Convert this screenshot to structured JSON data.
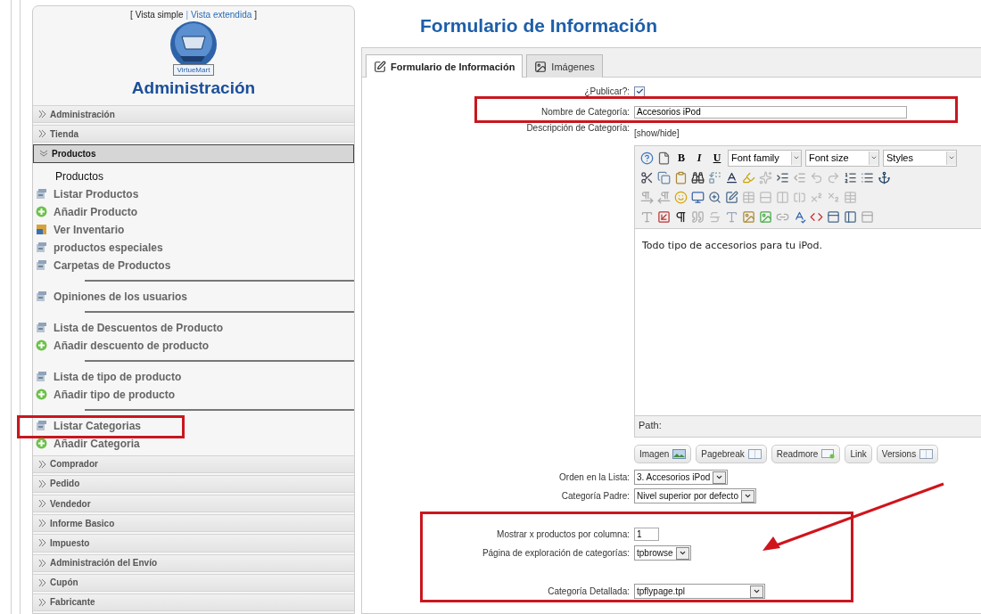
{
  "view_switch": {
    "prefix": "[",
    "separator": "|",
    "suffix": "]",
    "items": [
      {
        "label": "Vista simple",
        "selected": true
      },
      {
        "label": "Vista extendida",
        "selected": false
      }
    ]
  },
  "logo": {
    "text": "VirtueMart"
  },
  "sidebar_title": "Administración",
  "sidebar": {
    "sections": [
      {
        "label": "Administración",
        "expanded": false
      },
      {
        "label": "Tienda",
        "expanded": false
      },
      {
        "label": "Productos",
        "expanded": true,
        "groups": [
          [
            {
              "label": "Productos",
              "kind": "heading",
              "highlighted": false
            },
            {
              "label": "Listar Productos",
              "kind": "list",
              "highlighted": false
            },
            {
              "label": "Añadir Producto",
              "kind": "add",
              "highlighted": false
            },
            {
              "label": "Ver Inventario",
              "kind": "inventory",
              "highlighted": false
            },
            {
              "label": "productos especiales",
              "kind": "list",
              "highlighted": false
            },
            {
              "label": "Carpetas de Productos",
              "kind": "list",
              "highlighted": false
            }
          ],
          [
            {
              "label": "Opiniones de los usuarios",
              "kind": "list",
              "highlighted": false
            }
          ],
          [
            {
              "label": "Lista de Descuentos de Producto",
              "kind": "list",
              "highlighted": false
            },
            {
              "label": "Añadir descuento de producto",
              "kind": "add",
              "highlighted": false
            }
          ],
          [
            {
              "label": "Lista de tipo de producto",
              "kind": "list",
              "highlighted": false
            },
            {
              "label": "Añadir tipo de producto",
              "kind": "add",
              "highlighted": false
            }
          ],
          [
            {
              "label": "Listar Categorias",
              "kind": "list",
              "highlighted": true
            },
            {
              "label": "Añadir Categoria",
              "kind": "add",
              "highlighted": false
            }
          ]
        ]
      },
      {
        "label": "Comprador",
        "expanded": false
      },
      {
        "label": "Pedido",
        "expanded": false
      },
      {
        "label": "Vendedor",
        "expanded": false
      },
      {
        "label": "Informe Basico",
        "expanded": false
      },
      {
        "label": "Impuesto",
        "expanded": false
      },
      {
        "label": "Administración del Envío",
        "expanded": false
      },
      {
        "label": "Cupón",
        "expanded": false
      },
      {
        "label": "Fabricante",
        "expanded": false
      }
    ]
  },
  "page_title": "Formulario de Información",
  "tabs": [
    {
      "label": "Formulario de Información",
      "selected": true,
      "kind": "edit"
    },
    {
      "label": "Imágenes",
      "selected": false,
      "kind": "image"
    }
  ],
  "form": {
    "groups": [
      {
        "highlighted": false,
        "arrow": false,
        "rows": [
          {
            "label": "¿Publicar?:",
            "kind": "checkbox",
            "checked": true
          }
        ]
      },
      {
        "highlighted": true,
        "arrow": false,
        "rows": [
          {
            "label": "Nombre de Categoría:",
            "kind": "text",
            "value": "Accesorios iPod"
          }
        ]
      },
      {
        "highlighted": false,
        "arrow": false,
        "rows": [
          {
            "label": "Descripción de Categoría:",
            "kind": "editor"
          }
        ]
      },
      {
        "highlighted": false,
        "arrow": false,
        "rows": [
          {
            "label": "Orden en la Lista:",
            "kind": "select",
            "value": "3. Accesorios iPod"
          },
          {
            "label": "Categoría Padre:",
            "kind": "select",
            "value": "Nivel superior por defecto"
          }
        ]
      },
      {
        "highlighted": true,
        "arrow": true,
        "rows": [
          {
            "label": "Mostrar x productos por columna:",
            "kind": "number",
            "value": "1"
          },
          {
            "label": "Página de exploración de categorías:",
            "kind": "select",
            "value": "tpbrowse"
          },
          {
            "label": "Categoría Detallada:",
            "kind": "wide_select",
            "value": "tpflypage.tpl"
          }
        ]
      }
    ]
  },
  "editor": {
    "toggle": "[show/hide]",
    "format_buttons": [
      "B",
      "I",
      "U"
    ],
    "dropdowns": [
      "Font family",
      "Font size",
      "Styles"
    ],
    "content": "Todo tipo de accesorios para tu iPod.",
    "path_label": "Path:",
    "buttons": [
      {
        "label": "Imagen",
        "kind": "image"
      },
      {
        "label": "Pagebreak",
        "kind": "pagebreak"
      },
      {
        "label": "Readmore",
        "kind": "readmore"
      },
      {
        "label": "Link",
        "kind": "none"
      },
      {
        "label": "Versions",
        "kind": "versions"
      }
    ]
  }
}
